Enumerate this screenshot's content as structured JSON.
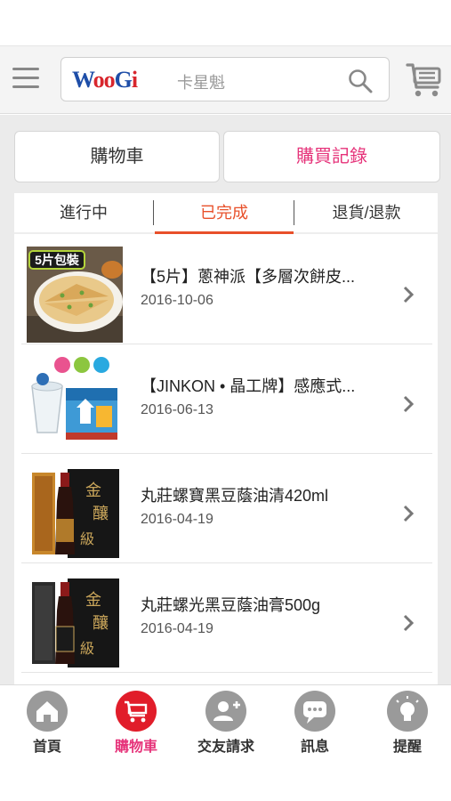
{
  "header": {
    "logo": {
      "w": "W",
      "oo": "oo",
      "g": "G",
      "i": "i"
    },
    "search_placeholder": "卡星魁"
  },
  "top_tabs": {
    "cart": "購物車",
    "history": "購買記錄"
  },
  "sub_tabs": {
    "in_progress": "進行中",
    "completed": "已完成",
    "returns": "退貨/退款"
  },
  "orders": [
    {
      "title": "【5片】蔥神派【多層次餅皮...",
      "date": "2016-10-06",
      "badge": "5片包裝"
    },
    {
      "title": "【JINKON • 晶工牌】感應式...",
      "date": "2016-06-13"
    },
    {
      "title": "丸莊螺寶黑豆蔭油清420ml",
      "date": "2016-04-19"
    },
    {
      "title": "丸莊螺光黑豆蔭油膏500g",
      "date": "2016-04-19"
    }
  ],
  "bottom_nav": [
    {
      "label": "首頁",
      "icon": "home-icon"
    },
    {
      "label": "購物車",
      "icon": "cart-icon",
      "active": true
    },
    {
      "label": "交友請求",
      "icon": "add-friend-icon"
    },
    {
      "label": "訊息",
      "icon": "message-icon"
    },
    {
      "label": "提醒",
      "icon": "lightbulb-icon"
    }
  ],
  "colors": {
    "accent_pink": "#e6337a",
    "accent_orange": "#e8502a",
    "cart_red": "#e11d2a",
    "icon_gray": "#9a9a9a"
  }
}
